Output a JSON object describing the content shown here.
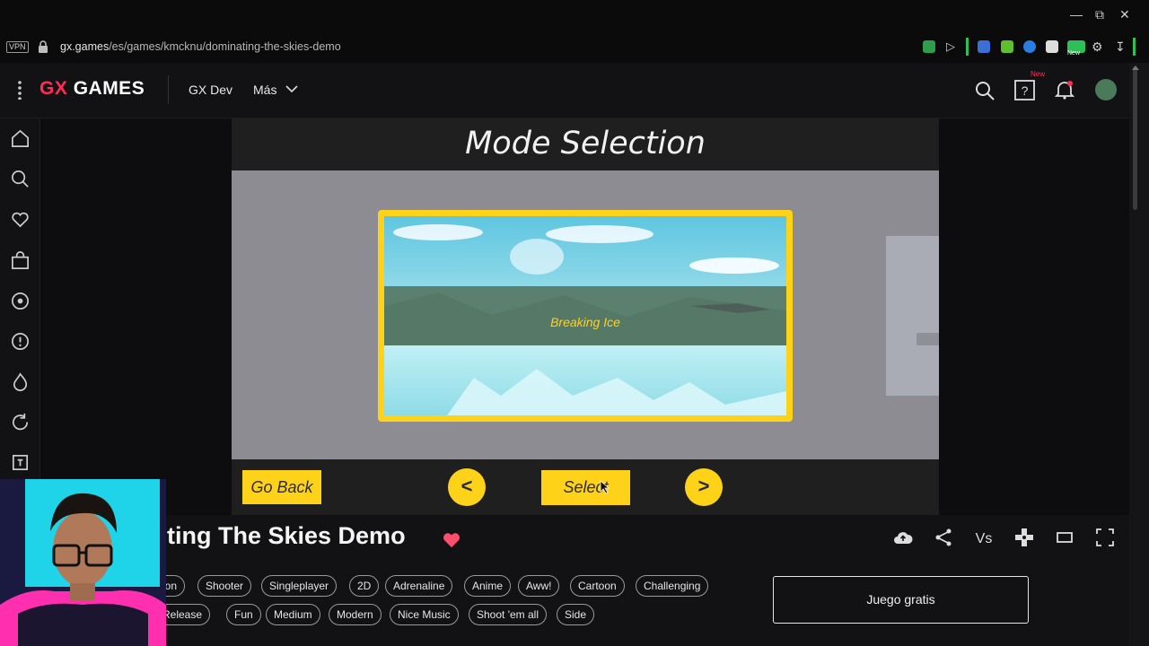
{
  "browser": {
    "vpn_label": "VPN",
    "url_host": "gx.games",
    "url_path": "/es/games/kmcknu/dominating-the-skies-demo",
    "extension_new_badge": "New"
  },
  "header": {
    "logo_gx": "GX",
    "logo_games": "GAMES",
    "nav": [
      {
        "label": "GX Dev"
      },
      {
        "label": "Más"
      }
    ],
    "new_badge": "New"
  },
  "game": {
    "mode_title": "Mode Selection",
    "card_label": "Breaking Ice",
    "go_back": "Go Back",
    "prev": "<",
    "select": "Select",
    "next": ">"
  },
  "page": {
    "title": "ting The Skies Demo",
    "tags_row1": [
      "ion",
      "Shooter",
      "Singleplayer",
      "2D",
      "Adrenaline",
      "Anime",
      "Aww!",
      "Cartoon",
      "Challenging"
    ],
    "tags_row2": [
      "Release",
      "Fun",
      "Medium",
      "Modern",
      "Nice Music",
      "Shoot 'em all",
      "Side"
    ],
    "free_button": "Juego gratis"
  },
  "colors": {
    "accent_yellow": "#ffd21a",
    "brand_red": "#ff2d55",
    "heart": "#ff4d6d"
  }
}
